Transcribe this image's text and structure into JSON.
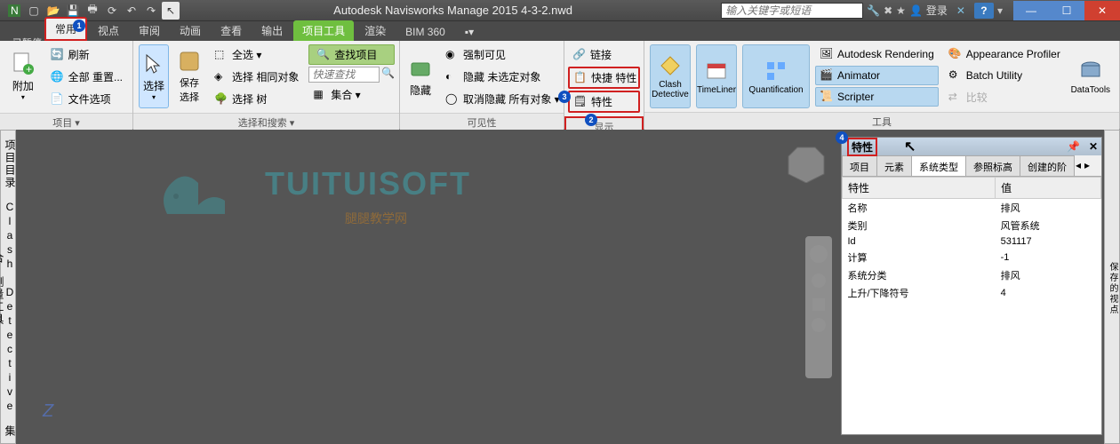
{
  "title": "Autodesk Navisworks Manage 2015   4-3-2.nwd",
  "search_placeholder": "输入关键字或短语",
  "login_label": "登录",
  "pause_label": "已暂停",
  "tabs": [
    "常用",
    "视点",
    "审阅",
    "动画",
    "查看",
    "输出",
    "项目工具",
    "渲染",
    "BIM 360"
  ],
  "active_tab": 0,
  "panels": {
    "p1": {
      "title": "项目 ▾",
      "big": "附加",
      "items": [
        "刷新",
        "全部 重置...",
        "文件选项"
      ]
    },
    "p2": {
      "title": "选择和搜索 ▾",
      "big1": "选择",
      "big2": "保存\n选择",
      "items": [
        "全选 ▾",
        "选择 相同对象",
        "选择 树"
      ],
      "find": "查找项目",
      "quick": "快速查找",
      "sets": "集合 ▾"
    },
    "p3": {
      "title": "可见性",
      "big": "隐藏",
      "items": [
        "强制可见",
        "隐藏 未选定对象",
        "取消隐藏 所有对象 ▾"
      ]
    },
    "p4": {
      "title": "显示",
      "items": [
        "链接",
        "快捷 特性",
        "特性"
      ]
    },
    "p5": {
      "title": "工具",
      "clash": "Clash\nDetective",
      "tl": "TimeLiner",
      "quant": "Quantification",
      "render": "Autodesk Rendering",
      "anim": "Animator",
      "scr": "Scripter",
      "appear": "Appearance Profiler",
      "batch": "Batch Utility",
      "compare": "比较",
      "dt": "DataTools"
    }
  },
  "vtabs_left": [
    "项目目录",
    "Clash Detective",
    "集合",
    "测量工具"
  ],
  "vtabs_right": "保存的视点",
  "props": {
    "title": "特性",
    "tabs": [
      "项目",
      "元素",
      "系统类型",
      "参照标高",
      "创建的阶"
    ],
    "active": 2,
    "headers": [
      "特性",
      "值"
    ],
    "rows": [
      [
        "名称",
        "排风"
      ],
      [
        "类别",
        "风管系统"
      ],
      [
        "Id",
        "531117"
      ],
      [
        "计算",
        "-1"
      ],
      [
        "系统分类",
        "排风"
      ],
      [
        "上升/下降符号",
        "4"
      ]
    ]
  },
  "markers": {
    "m1": "1",
    "m2": "2",
    "m3": "3",
    "m4": "4"
  },
  "watermark": "TUITUISOFT",
  "watermark_sub": "腿腿教学网",
  "compass": "Z"
}
